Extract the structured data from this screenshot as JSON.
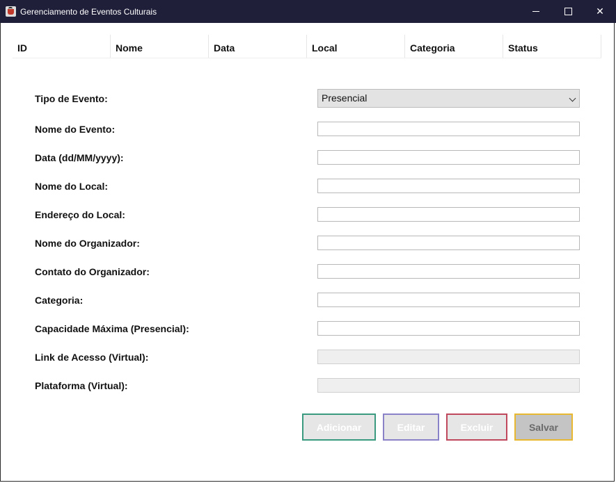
{
  "window": {
    "title": "Gerenciamento de Eventos Culturais"
  },
  "table": {
    "columns": [
      "ID",
      "Nome",
      "Data",
      "Local",
      "Categoria",
      "Status"
    ]
  },
  "form": {
    "tipo_label": "Tipo de Evento:",
    "tipo_value": "Presencial",
    "fields": [
      {
        "label": "Nome do Evento:",
        "value": "",
        "enabled": true
      },
      {
        "label": "Data (dd/MM/yyyy):",
        "value": "",
        "enabled": true
      },
      {
        "label": "Nome do Local:",
        "value": "",
        "enabled": true
      },
      {
        "label": "Endereço do Local:",
        "value": "",
        "enabled": true
      },
      {
        "label": "Nome do Organizador:",
        "value": "",
        "enabled": true
      },
      {
        "label": "Contato do Organizador:",
        "value": "",
        "enabled": true
      },
      {
        "label": "Categoria:",
        "value": "",
        "enabled": true
      },
      {
        "label": "Capacidade Máxima (Presencial):",
        "value": "",
        "enabled": true
      },
      {
        "label": "Link de Acesso (Virtual):",
        "value": "",
        "enabled": false
      },
      {
        "label": "Plataforma (Virtual):",
        "value": "",
        "enabled": false
      }
    ]
  },
  "buttons": {
    "adicionar": "Adicionar",
    "editar": "Editar",
    "excluir": "Excluir",
    "salvar": "Salvar"
  },
  "colors": {
    "titlebar": "#1f1f3a",
    "adicionar_border": "#3a9a80",
    "editar_border": "#8a82c8",
    "excluir_border": "#c0485c",
    "salvar_border": "#e8b830"
  },
  "icons": [
    "app-icon",
    "minimize-icon",
    "maximize-icon",
    "close-icon",
    "chevron-down-icon"
  ]
}
